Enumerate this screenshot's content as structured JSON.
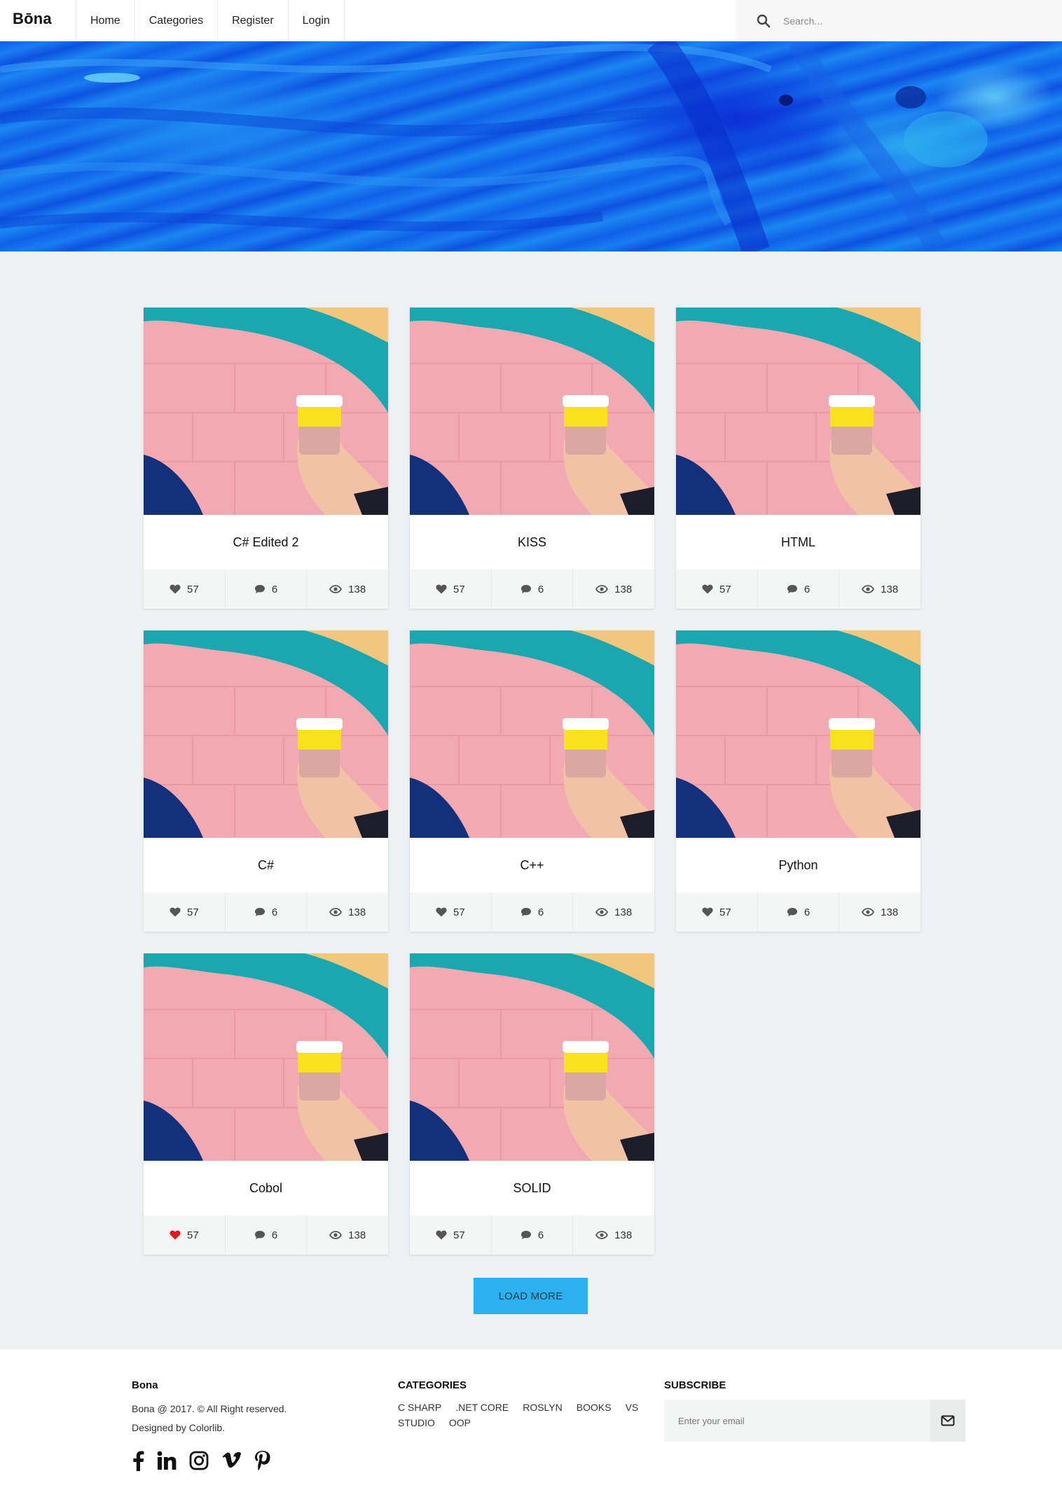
{
  "header": {
    "logo": "Bōna",
    "nav": [
      "Home",
      "Categories",
      "Register",
      "Login"
    ],
    "search_placeholder": "Search..."
  },
  "posts": [
    {
      "title": "C# Edited 2",
      "likes": "57",
      "comments": "6",
      "views": "138",
      "liked": false
    },
    {
      "title": "KISS",
      "likes": "57",
      "comments": "6",
      "views": "138",
      "liked": false
    },
    {
      "title": "HTML",
      "likes": "57",
      "comments": "6",
      "views": "138",
      "liked": false
    },
    {
      "title": "C#",
      "likes": "57",
      "comments": "6",
      "views": "138",
      "liked": false
    },
    {
      "title": "C++",
      "likes": "57",
      "comments": "6",
      "views": "138",
      "liked": false
    },
    {
      "title": "Python",
      "likes": "57",
      "comments": "6",
      "views": "138",
      "liked": false
    },
    {
      "title": "Cobol",
      "likes": "57",
      "comments": "6",
      "views": "138",
      "liked": true
    },
    {
      "title": "SOLID",
      "likes": "57",
      "comments": "6",
      "views": "138",
      "liked": false
    }
  ],
  "load_more": "LOAD MORE",
  "colors": {
    "accent": "#2bb2ee",
    "liked_heart": "#e5161e",
    "heart": "#555555",
    "page_bg": "#edf1f2"
  },
  "footer": {
    "brand": "Bona",
    "copyright": "Bona @ 2017. © All Right reserved.",
    "designed_by": "Designed by Colorlib.",
    "categories_title": "CATEGORIES",
    "categories": [
      "C SHARP",
      ".NET CORE",
      "ROSLYN",
      "BOOKS",
      "VS STUDIO",
      "OOP"
    ],
    "subscribe_title": "SUBSCRIBE",
    "email_placeholder": "Enter your email",
    "socials": [
      "facebook-icon",
      "linkedin-icon",
      "instagram-icon",
      "vimeo-icon",
      "pinterest-icon"
    ]
  }
}
